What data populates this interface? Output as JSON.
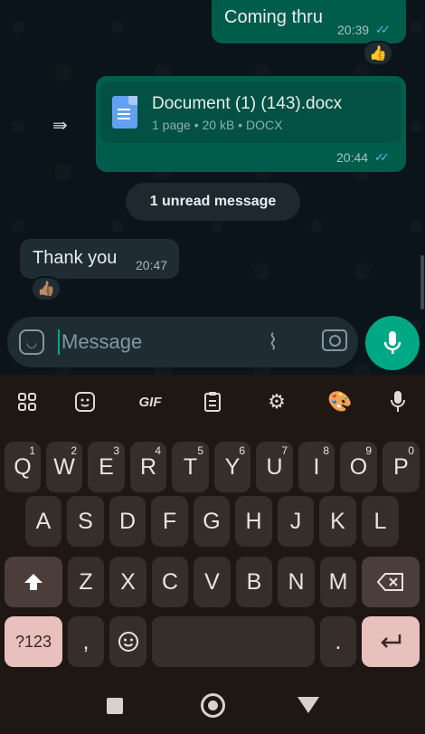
{
  "chat": {
    "messages": [
      {
        "type": "outgoing",
        "text": "Coming thru",
        "time": "20:39",
        "status": "read",
        "reaction": "👍"
      },
      {
        "type": "outgoing-document",
        "forwarded": true,
        "doc_name": "Document (1) (143).docx",
        "doc_info": "1 page • 20 kB • DOCX",
        "time": "20:44",
        "status": "read"
      },
      {
        "type": "incoming",
        "text": "Thank you",
        "time": "20:47",
        "reaction": "👍🏽"
      }
    ],
    "unread_banner": "1 unread message"
  },
  "input": {
    "placeholder": "Message"
  },
  "colors": {
    "outgoing_bubble": "#005c4b",
    "incoming_bubble": "#202c33",
    "accent": "#00a884",
    "read_ticks": "#53bdeb"
  },
  "keyboard": {
    "toolbar": {
      "gif_label": "GIF"
    },
    "row1": [
      {
        "k": "Q",
        "n": "1"
      },
      {
        "k": "W",
        "n": "2"
      },
      {
        "k": "E",
        "n": "3"
      },
      {
        "k": "R",
        "n": "4"
      },
      {
        "k": "T",
        "n": "5"
      },
      {
        "k": "Y",
        "n": "6"
      },
      {
        "k": "U",
        "n": "7"
      },
      {
        "k": "I",
        "n": "8"
      },
      {
        "k": "O",
        "n": "9"
      },
      {
        "k": "P",
        "n": "0"
      }
    ],
    "row2": [
      "A",
      "S",
      "D",
      "F",
      "G",
      "H",
      "J",
      "K",
      "L"
    ],
    "row3": [
      "Z",
      "X",
      "C",
      "V",
      "B",
      "N",
      "M"
    ],
    "symbols_label": "?123",
    "comma_label": ",",
    "period_label": "."
  }
}
